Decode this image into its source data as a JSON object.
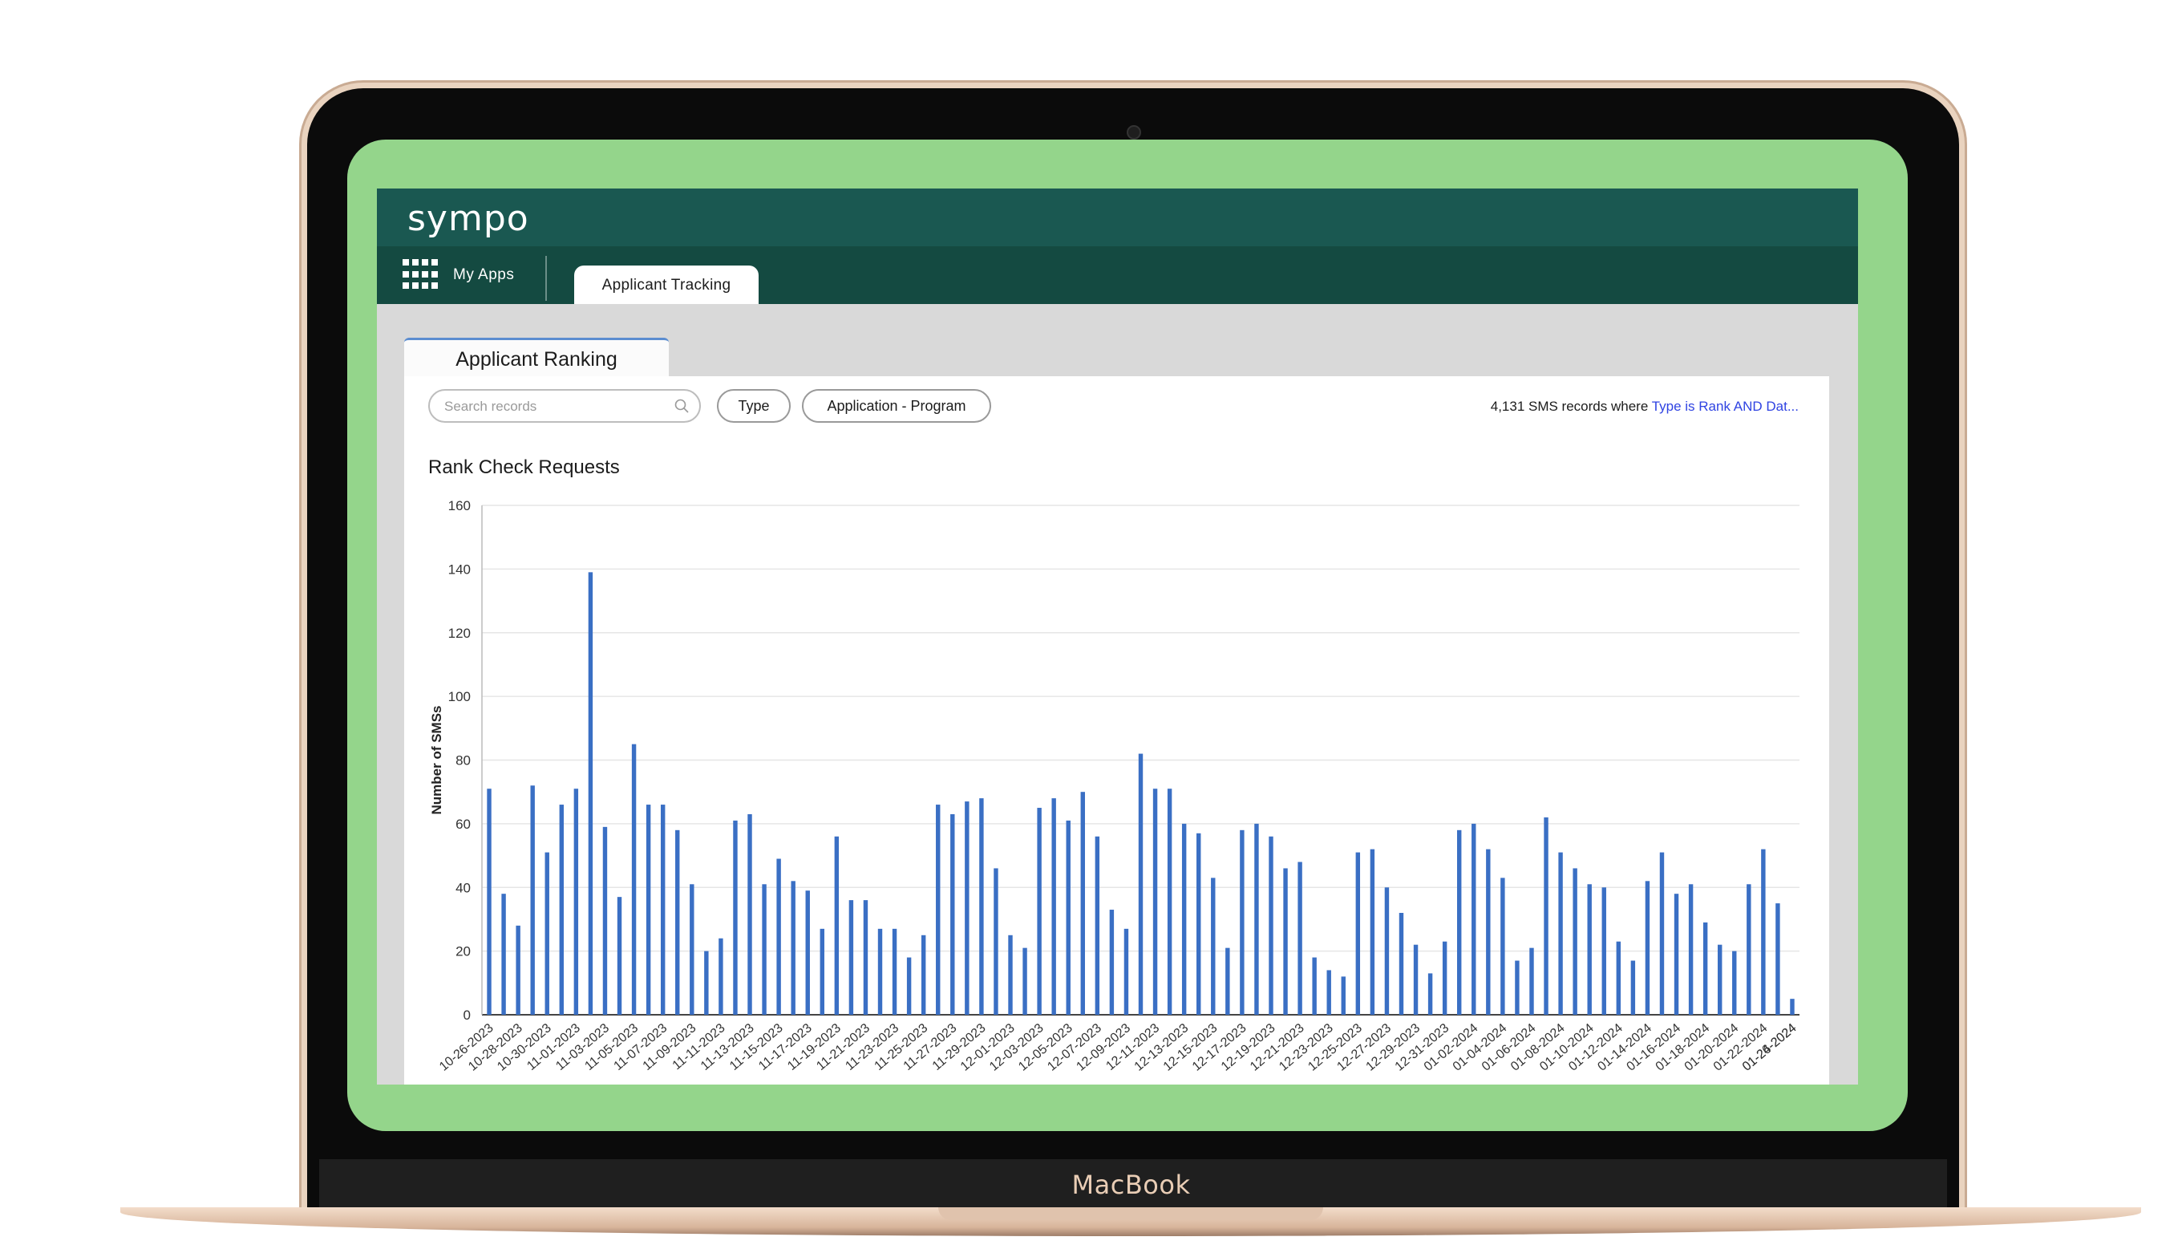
{
  "device": {
    "brand_label": "MacBook"
  },
  "app": {
    "logo": "sympo",
    "nav": {
      "my_apps": "My Apps",
      "active_tab": "Applicant Tracking"
    },
    "page_tab": "Applicant Ranking",
    "filters": {
      "search_placeholder": "Search records",
      "chips": [
        "Type",
        "Application - Program"
      ]
    },
    "records_summary": {
      "text": "4,131 SMS records where ",
      "link": "Type is Rank AND Dat..."
    }
  },
  "colors": {
    "bar": "#3a6fc4",
    "header": "#1a5851",
    "nav": "#144a41",
    "screen_bg": "#94d58b",
    "link": "#2f43e2"
  },
  "chart_data": {
    "type": "bar",
    "title": "Rank Check Requests",
    "ylabel": "Number of SMSs",
    "xlabel": "",
    "ylim": [
      0,
      160
    ],
    "yticks": [
      0,
      20,
      40,
      60,
      80,
      100,
      120,
      140,
      160
    ],
    "grid": true,
    "x_tick_labels": [
      "10-26-2023",
      "10-28-2023",
      "10-30-2023",
      "11-01-2023",
      "11-03-2023",
      "11-05-2023",
      "11-07-2023",
      "11-09-2023",
      "11-11-2023",
      "11-13-2023",
      "11-15-2023",
      "11-17-2023",
      "11-19-2023",
      "11-21-2023",
      "11-23-2023",
      "11-25-2023",
      "11-27-2023",
      "11-29-2023",
      "12-01-2023",
      "12-03-2023",
      "12-05-2023",
      "12-07-2023",
      "12-09-2023",
      "12-11-2023",
      "12-13-2023",
      "12-15-2023",
      "12-17-2023",
      "12-19-2023",
      "12-21-2023",
      "12-23-2023",
      "12-25-2023",
      "12-27-2023",
      "12-29-2023",
      "12-31-2023",
      "01-02-2024",
      "01-04-2024",
      "01-06-2024",
      "01-08-2024",
      "01-10-2024",
      "01-12-2024",
      "01-14-2024",
      "01-16-2024",
      "01-18-2024",
      "01-20-2024",
      "01-22-2024",
      "01-24-2024",
      "01-26-2024"
    ],
    "values": [
      71,
      38,
      28,
      72,
      51,
      66,
      71,
      139,
      59,
      37,
      85,
      66,
      66,
      58,
      41,
      20,
      24,
      61,
      63,
      41,
      49,
      42,
      39,
      27,
      56,
      36,
      36,
      27,
      27,
      18,
      25,
      66,
      63,
      67,
      68,
      46,
      25,
      21,
      65,
      68,
      61,
      70,
      56,
      33,
      27,
      82,
      71,
      71,
      60,
      57,
      43,
      21,
      58,
      60,
      56,
      46,
      48,
      18,
      14,
      12,
      51,
      52,
      40,
      32,
      22,
      13,
      23,
      58,
      60,
      52,
      43,
      17,
      21,
      62,
      51,
      46,
      41,
      40,
      23,
      17,
      42,
      51,
      38,
      41,
      29,
      22,
      20,
      41,
      52,
      35,
      5
    ]
  }
}
